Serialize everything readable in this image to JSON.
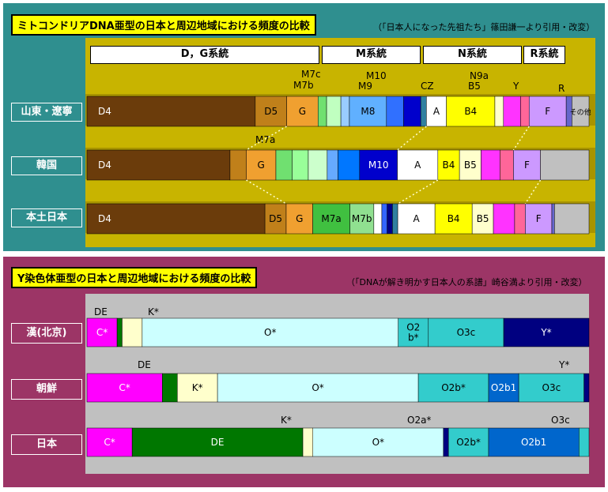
{
  "chart_data": [
    {
      "type": "bar",
      "stacked": true,
      "title": "ミトコンドリアDNA亜型の日本と周辺地域における頻度の比較",
      "citation": "（「日本人になった先祖たち」篠田謙一より引用・改変）",
      "groups": [
        "D，G系統",
        "M系統",
        "N系統",
        "R系統"
      ],
      "categories": [
        "山東・遼寧",
        "韓国",
        "本土日本"
      ],
      "colors": {
        "bg": "#2f8f8f",
        "band": "#c8b400"
      },
      "series": [
        {
          "row": "山東・遼寧",
          "segments": [
            {
              "label": "D4",
              "value": 29.5,
              "color": "#6b3c0b"
            },
            {
              "label": "D5",
              "value": 5.5,
              "color": "#c0801a"
            },
            {
              "label": "G",
              "value": 5.5,
              "color": "#f0a030"
            },
            {
              "label": "",
              "value": 1.5,
              "color": "#70e070"
            },
            {
              "label": "",
              "value": 2.5,
              "color": "#c0ffc0"
            },
            {
              "label": "",
              "value": 1.5,
              "color": "#99ccff"
            },
            {
              "label": "M8",
              "value": 6.5,
              "color": "#60b0ff"
            },
            {
              "label": "",
              "value": 3,
              "color": "#3070ff"
            },
            {
              "label": "",
              "value": 3,
              "color": "#0000cc"
            },
            {
              "label": "",
              "value": 1,
              "color": "#3080a0"
            },
            {
              "label": "A",
              "value": 3.5,
              "color": "#ffffff"
            },
            {
              "label": "B4",
              "value": 8.5,
              "color": "#ffff00"
            },
            {
              "label": "",
              "value": 1.5,
              "color": "#ffffcc"
            },
            {
              "label": "",
              "value": 3,
              "color": "#ff33ff"
            },
            {
              "label": "",
              "value": 1.5,
              "color": "#ff6699"
            },
            {
              "label": "F",
              "value": 6.5,
              "color": "#cc99ff"
            },
            {
              "label": "",
              "value": 1,
              "color": "#6666cc"
            },
            {
              "label": "その他",
              "value": 3,
              "color": "#c0c0c0"
            }
          ]
        },
        {
          "row": "韓国",
          "segments": [
            {
              "label": "D4",
              "value": 26.5,
              "color": "#6b3c0b"
            },
            {
              "label": "",
              "value": 3,
              "color": "#c0801a"
            },
            {
              "label": "G",
              "value": 5.5,
              "color": "#f0a030"
            },
            {
              "label": "",
              "value": 3,
              "color": "#70e070"
            },
            {
              "label": "",
              "value": 3,
              "color": "#99ff99"
            },
            {
              "label": "",
              "value": 3.5,
              "color": "#ccffcc"
            },
            {
              "label": "",
              "value": 2,
              "color": "#66aaff"
            },
            {
              "label": "",
              "value": 4,
              "color": "#0077ff"
            },
            {
              "label": "M10",
              "value": 7,
              "color": "#0000cc"
            },
            {
              "label": "A",
              "value": 7.5,
              "color": "#ffffff"
            },
            {
              "label": "B4",
              "value": 4,
              "color": "#ffff00"
            },
            {
              "label": "B5",
              "value": 4,
              "color": "#ffffcc"
            },
            {
              "label": "",
              "value": 3.5,
              "color": "#ff33ff"
            },
            {
              "label": "",
              "value": 2.5,
              "color": "#ff6699"
            },
            {
              "label": "F",
              "value": 5,
              "color": "#cc99ff"
            },
            {
              "label": "",
              "value": 9,
              "color": "#c0c0c0"
            }
          ]
        },
        {
          "row": "本土日本",
          "segments": [
            {
              "label": "D4",
              "value": 33.5,
              "color": "#6b3c0b"
            },
            {
              "label": "D5",
              "value": 4,
              "color": "#c0801a"
            },
            {
              "label": "G",
              "value": 5,
              "color": "#f0a030"
            },
            {
              "label": "M7a",
              "value": 7,
              "color": "#40c040"
            },
            {
              "label": "M7b",
              "value": 4.5,
              "color": "#90e090"
            },
            {
              "label": "",
              "value": 1.5,
              "color": "#ffffff"
            },
            {
              "label": "",
              "value": 1,
              "color": "#3366ff"
            },
            {
              "label": "",
              "value": 1,
              "color": "#000088"
            },
            {
              "label": "",
              "value": 1,
              "color": "#3080a0"
            },
            {
              "label": "A",
              "value": 7,
              "color": "#ffffff"
            },
            {
              "label": "B4",
              "value": 7,
              "color": "#ffff00"
            },
            {
              "label": "B5",
              "value": 4,
              "color": "#ffffcc"
            },
            {
              "label": "",
              "value": 4,
              "color": "#ff33ff"
            },
            {
              "label": "",
              "value": 2,
              "color": "#ff6699"
            },
            {
              "label": "F",
              "value": 5,
              "color": "#cc99ff"
            },
            {
              "label": "",
              "value": 0.5,
              "color": "#6666cc"
            },
            {
              "label": "",
              "value": 6.5,
              "color": "#c0c0c0"
            }
          ]
        }
      ],
      "annotations": [
        "M7c",
        "M7b",
        "M10",
        "M9",
        "CZ",
        "N9a",
        "B5",
        "Y",
        "R",
        "M7a"
      ]
    },
    {
      "type": "bar",
      "stacked": true,
      "title": "Y染色体亜型の日本と周辺地域における頻度の比較",
      "citation": "（「DNAが解き明かす日本人の系譜」崎谷満より引用・改変）",
      "categories": [
        "漢(北京)",
        "朝鮮",
        "日本"
      ],
      "colors": {
        "bg": "#9c3566",
        "band": "#c0c0c0"
      },
      "series": [
        {
          "row": "漢(北京)",
          "segments": [
            {
              "label": "C*",
              "value": 6,
              "color": "#ff00ff"
            },
            {
              "label": "",
              "value": 1,
              "color": "#007700"
            },
            {
              "label": "",
              "value": 4,
              "color": "#ffffcc"
            },
            {
              "label": "O*",
              "value": 51,
              "color": "#ccffff"
            },
            {
              "label": "O2\nb*",
              "value": 6,
              "color": "#33cccc"
            },
            {
              "label": "O3c",
              "value": 15,
              "color": "#33cccc"
            },
            {
              "label": "Y*",
              "value": 17,
              "color": "#000080"
            }
          ]
        },
        {
          "row": "朝鮮",
          "segments": [
            {
              "label": "C*",
              "value": 15,
              "color": "#ff00ff"
            },
            {
              "label": "",
              "value": 3,
              "color": "#007700"
            },
            {
              "label": "K*",
              "value": 8,
              "color": "#ffffcc"
            },
            {
              "label": "O*",
              "value": 40,
              "color": "#ccffff"
            },
            {
              "label": "O2b*",
              "value": 14,
              "color": "#33cccc"
            },
            {
              "label": "O2b1",
              "value": 6,
              "color": "#0066cc"
            },
            {
              "label": "O3c",
              "value": 13,
              "color": "#33cccc"
            },
            {
              "label": "",
              "value": 1,
              "color": "#000080"
            }
          ]
        },
        {
          "row": "日本",
          "segments": [
            {
              "label": "C*",
              "value": 9,
              "color": "#ff00ff"
            },
            {
              "label": "DE",
              "value": 34,
              "color": "#007700"
            },
            {
              "label": "",
              "value": 2,
              "color": "#ffffcc"
            },
            {
              "label": "O*",
              "value": 26,
              "color": "#ccffff"
            },
            {
              "label": "",
              "value": 1,
              "color": "#000080"
            },
            {
              "label": "O2b*",
              "value": 8,
              "color": "#33cccc"
            },
            {
              "label": "O2b1",
              "value": 18,
              "color": "#0066cc"
            },
            {
              "label": "",
              "value": 2,
              "color": "#33cccc"
            }
          ]
        }
      ],
      "annotations": [
        "DE",
        "K*",
        "DE",
        "Y*",
        "K*",
        "O2a*",
        "O3c"
      ]
    }
  ]
}
